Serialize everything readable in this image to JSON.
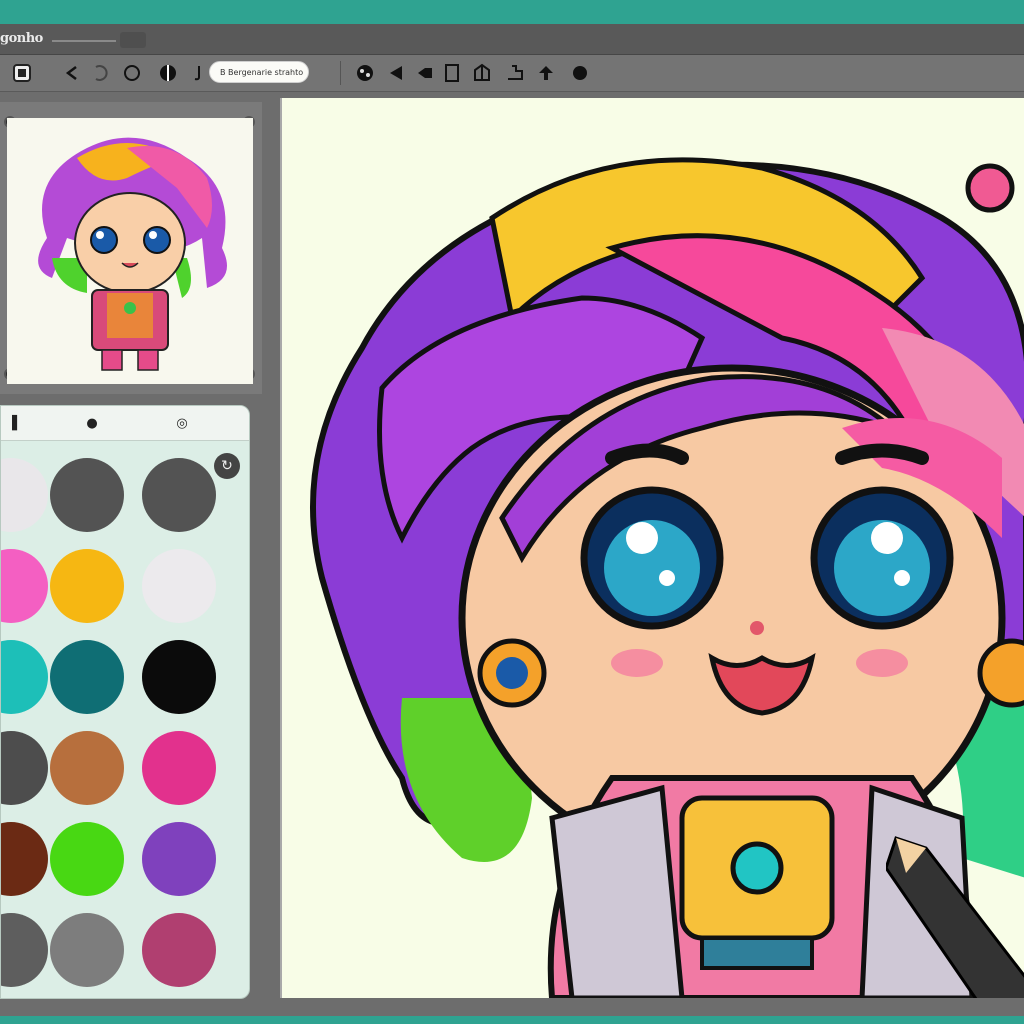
{
  "app": {
    "title": "gonho"
  },
  "toolbar": {
    "search_text": "B  Bergenarie strahto",
    "tools": [
      "home-icon",
      "undo-icon",
      "redo-icon",
      "lasso-icon",
      "fill-icon",
      "text-icon",
      "shapes-icon",
      "pen-icon",
      "eraser-icon",
      "frame-icon",
      "perspective-icon",
      "layer-icon",
      "upload-icon",
      "color-dot-icon"
    ]
  },
  "palette": {
    "tabs": [
      "palette-tab-icon",
      "swatches-tab-icon",
      "settings-tab-icon"
    ],
    "refresh_icon": "refresh-icon",
    "colors": [
      "#e9e7ea",
      "#535353",
      "#535353",
      "#f45fc2",
      "#f6b712",
      "#eceaed",
      "#1dbfb8",
      "#0f6e74",
      "#0b0b0b",
      "#4d4d4d",
      "#b76f3d",
      "#e2318d",
      "#6b2a14",
      "#48d813",
      "#7f41bd",
      "#5e5e5e",
      "#7d7d7d",
      "#b03f70"
    ]
  },
  "colors": {
    "accent": "#2fa391",
    "canvas_bg": "#f8fde7"
  }
}
